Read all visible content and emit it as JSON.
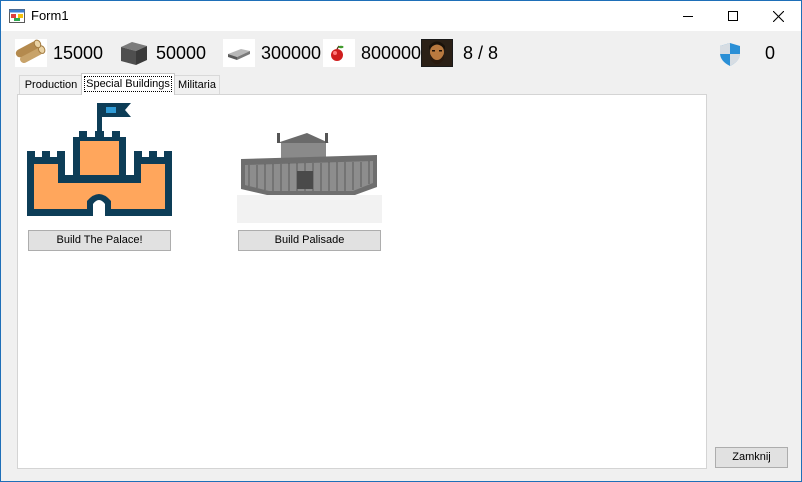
{
  "window": {
    "title": "Form1"
  },
  "resources": [
    {
      "name": "wood",
      "icon": "wood-logs-icon",
      "value": "15000"
    },
    {
      "name": "stone",
      "icon": "stone-block-icon",
      "value": "50000"
    },
    {
      "name": "iron",
      "icon": "iron-ingot-icon",
      "value": "300000"
    },
    {
      "name": "food",
      "icon": "apple-icon",
      "value": "800000"
    },
    {
      "name": "population",
      "icon": "settler-portrait-icon",
      "value": "8 / 8"
    }
  ],
  "defense": {
    "icon": "shield-icon",
    "value": "0"
  },
  "tabs": [
    {
      "label": "Production",
      "active": false
    },
    {
      "label": "Special Buildings",
      "active": true
    },
    {
      "label": "Militaria",
      "active": false
    }
  ],
  "buildings": [
    {
      "image": "castle-icon",
      "button_label": "Build The Palace!"
    },
    {
      "image": "palisade-image",
      "button_label": "Build Palisade"
    }
  ],
  "close_button_label": "Zamknij",
  "colors": {
    "castle_orange": "#ffa65c",
    "castle_navy": "#0d3d57",
    "flag_blue": "#2f9bd6",
    "shield_blue": "#2a8fd6"
  }
}
